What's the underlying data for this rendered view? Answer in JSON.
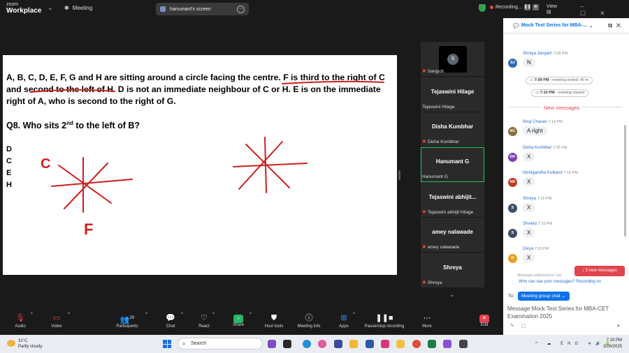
{
  "topbar": {
    "logo_small": "zoom",
    "logo_big": "Workplace",
    "meeting_label": "Meeting",
    "share_title": "hanumant's screen",
    "recording_label": "Recording...",
    "view_label": "View"
  },
  "slide": {
    "line1_a": "A, B, C, D, E, F, G and H are sitting around a circle facing the centre. ",
    "line1_b": "F is third to the right of C",
    "line2": " and second to the left of H. D is not an immediate neighbour of C or H. E is on the immediate right of A, who is second to the right of G.",
    "question_a": "Q8. Who sits 2",
    "question_sup": "nd",
    "question_b": " to the left  of B?",
    "options": [
      "D",
      "C",
      "E",
      "H"
    ],
    "ink_c": "C",
    "ink_f": "F",
    "ink_color": "#cc1f1f"
  },
  "participants": [
    {
      "name": "",
      "label": "Sanjyoti",
      "avatar": "S",
      "muted": true
    },
    {
      "name": "Tejaswini Hilage",
      "label": "Tejaswini Hilage",
      "muted": false
    },
    {
      "name": "Disha Kumbhar",
      "label": "Disha Kumbhar",
      "muted": true
    },
    {
      "name": "Hanumant G",
      "label": "Hanumant G",
      "muted": false,
      "active": true
    },
    {
      "name": "Tejaswini  abhijit...",
      "label": "Tejaswini abhijit Hilage",
      "muted": true
    },
    {
      "name": "amey nalawade",
      "label": "amey nalawade",
      "muted": true
    },
    {
      "name": "Shreya",
      "label": "Shreya",
      "muted": true
    }
  ],
  "chat": {
    "title": "Mock Test Series for MBA-...",
    "messages": [
      {
        "sender": "Shreya Jangam",
        "time": "7:08 PM",
        "text": "N",
        "initials": "SJ",
        "color": "#2e6db4"
      },
      {
        "sender": "Niraj Chavan",
        "time": "7:14 PM",
        "text": "A right",
        "initials": "NC",
        "color": "#8a6d3b"
      },
      {
        "sender": "Disha Kumbhar",
        "time": "7:15 PM",
        "text": "X",
        "initials": "DK",
        "color": "#7b3fb2"
      },
      {
        "sender": "Nishigandha Kulkarni",
        "time": "7:15 PM",
        "text": "X",
        "initials": "NK",
        "color": "#c23b22"
      },
      {
        "sender": "Shreya",
        "time": "7:15 PM",
        "text": "X",
        "initials": "S",
        "color": "#3d4f66"
      },
      {
        "sender": "Shweta",
        "time": "7:15 PM",
        "text": "X",
        "initials": "S",
        "color": "#3d4f66"
      },
      {
        "sender": "Divya",
        "time": "7:15 PM",
        "text": "X",
        "initials": "D",
        "color": "#e8a020"
      }
    ],
    "sys1_time": "7:09 PM",
    "sys1_text": " - meeting ended: 40 m",
    "sys2_time": "7:10 PM",
    "sys2_text": " - meeting started",
    "new_messages_divider": "New messages",
    "new_messages_button": "5 new messages",
    "addressed_note": "Messages addressed to \"me",
    "who_can_see": "Who can see your messages? Recording on",
    "to_label": "To:",
    "to_value": "Meeting group chat",
    "compose_text": "Message Mock Test Series for MBA-CET Examination 2025"
  },
  "toolbar": {
    "audio": "Audio",
    "video": "Video",
    "participants": "Participants",
    "participant_count": "20",
    "chat": "Chat",
    "react": "React",
    "share": "Share",
    "host_tools": "Host tools",
    "meeting_info": "Meeting info",
    "apps": "Apps",
    "pause_recording": "Pause/stop recording",
    "more": "More",
    "end": "End"
  },
  "taskbar": {
    "temperature": "31°C",
    "weather": "Partly cloudy",
    "search": "Search",
    "lang": "ENG",
    "time": "7:19 PM",
    "date": "3/26/2025"
  }
}
